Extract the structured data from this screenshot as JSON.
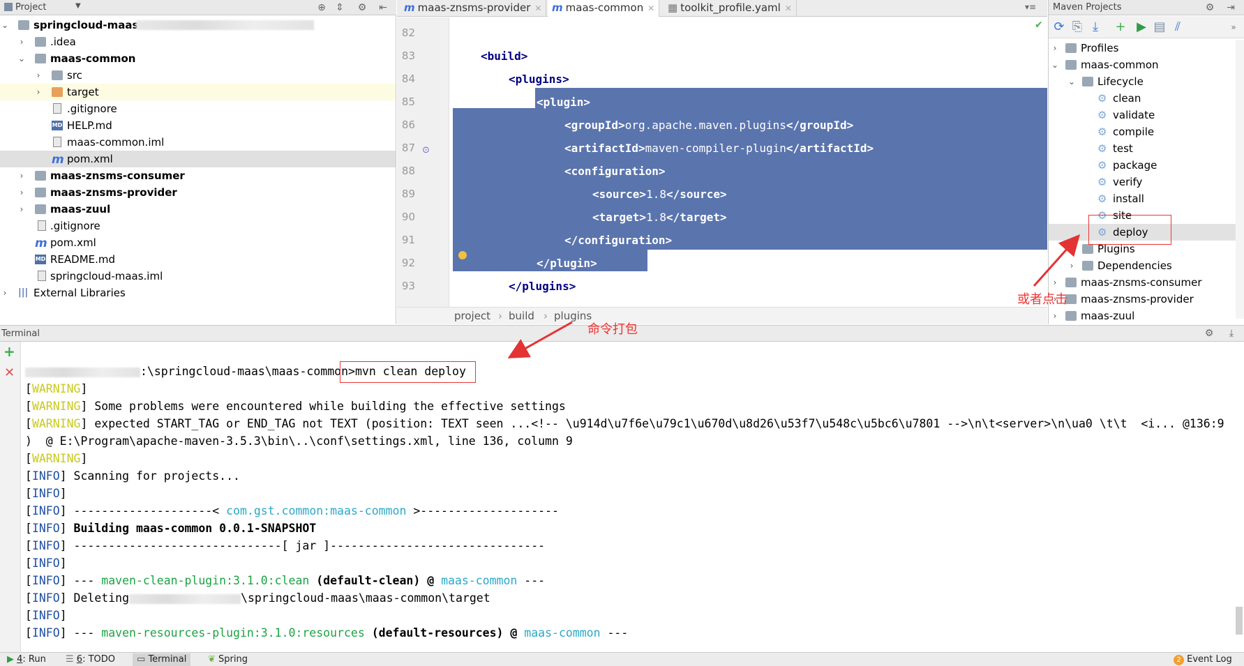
{
  "project": {
    "header_title": "Project",
    "tree": [
      {
        "label": "springcloud-maas",
        "bold": true
      },
      {
        "label": ".idea"
      },
      {
        "label": "maas-common",
        "bold": true
      },
      {
        "label": "src"
      },
      {
        "label": "target"
      },
      {
        "label": ".gitignore"
      },
      {
        "label": "HELP.md"
      },
      {
        "label": "maas-common.iml"
      },
      {
        "label": "pom.xml"
      },
      {
        "label": "maas-znsms-consumer",
        "bold": true
      },
      {
        "label": "maas-znsms-provider",
        "bold": true
      },
      {
        "label": "maas-zuul",
        "bold": true
      },
      {
        "label": ".gitignore"
      },
      {
        "label": "pom.xml"
      },
      {
        "label": "README.md"
      },
      {
        "label": "springcloud-maas.iml"
      },
      {
        "label": "External Libraries"
      }
    ],
    "icons": {
      "md_badge": "MD",
      "maven_glyph": "m"
    }
  },
  "editor": {
    "tabs": [
      {
        "label": "maas-znsms-provider"
      },
      {
        "label": "maas-common"
      },
      {
        "label": "toolkit_profile.yaml"
      }
    ],
    "line_numbers": [
      "82",
      "83",
      "84",
      "85",
      "86",
      "87",
      "88",
      "89",
      "90",
      "91",
      "92",
      "93"
    ],
    "code": {
      "l83": "<build>",
      "l84": "<plugins>",
      "l85": "<plugin>",
      "l86_open": "<groupId>",
      "l86_val": "org.apache.maven.plugins",
      "l86_close": "</groupId>",
      "l87_open": "<artifactId>",
      "l87_val": "maven-compiler-plugin",
      "l87_close": "</artifactId>",
      "l88": "<configuration>",
      "l89_open": "<source>",
      "l89_val": "1.8",
      "l89_close": "</source>",
      "l90_open": "<target>",
      "l90_val": "1.8",
      "l90_close": "</target>",
      "l91": "</configuration>",
      "l92": "</plugin>",
      "l93": "</plugins>"
    },
    "breadcrumb": [
      "project",
      "build",
      "plugins"
    ],
    "breadcrumb_sep": "›"
  },
  "maven": {
    "header_title": "Maven Projects",
    "tree": {
      "profiles": "Profiles",
      "project": "maas-common",
      "lifecycle": "Lifecycle",
      "goals": [
        "clean",
        "validate",
        "compile",
        "test",
        "package",
        "verify",
        "install",
        "site",
        "deploy"
      ],
      "plugins": "Plugins",
      "dependencies": "Dependencies",
      "others": [
        "maas-znsms-consumer",
        "maas-znsms-provider",
        "maas-zuul"
      ]
    }
  },
  "terminal": {
    "title": "Terminal",
    "prompt_path": ":\\springcloud-maas\\maas-common>",
    "command": "mvn clean deploy",
    "tag_warning": "WARNING",
    "tag_info": "INFO",
    "lines": {
      "w2": " Some problems were encountered while building the effective settings",
      "w3": " expected START_TAG or END_TAG not TEXT (position: TEXT seen ...<!-- \\u914d\\u7f6e\\u79c1\\u670d\\u8d26\\u53f7\\u548c\\u5bc6\\u7801 -->\\n\\t<server>\\n\\ua0 \\t\\t  <i... @136:9",
      "w3b": ")  @ E:\\Program\\apache-maven-3.5.3\\bin\\..\\conf\\settings.xml, line 136, column 9",
      "i1": " Scanning for projects...",
      "i3_pre": " --------------------< ",
      "i3_art": "com.gst.common:maas-common",
      "i3_post": " >--------------------",
      "i4": " Building maas-common 0.0.1-SNAPSHOT",
      "i5": " ------------------------------[ jar ]-------------------------------",
      "i7_pre": " --- ",
      "i7_plugin": "maven-clean-plugin:3.1.0:clean",
      "i7_mid": " (default-clean) @ ",
      "i7_mod": "maas-common",
      "i7_post": " ---",
      "i8_pre": " Deleting",
      "i8_post": "\\springcloud-maas\\maas-common\\target",
      "i10_pre": " --- ",
      "i10_plugin": "maven-resources-plugin:3.1.0:resources",
      "i10_mid": " (default-resources) @ ",
      "i10_mod": "maas-common",
      "i10_post": " ---"
    }
  },
  "status_bar": {
    "run_num": "4",
    "run": ": Run",
    "todo_num": "6",
    "todo": ": TODO",
    "terminal": "Terminal",
    "spring": "Spring",
    "event_count": "2",
    "event_log": "Event Log"
  },
  "annotations": {
    "command_note": "命令打包",
    "click_note": "或者点击",
    "color": "#e33333"
  }
}
